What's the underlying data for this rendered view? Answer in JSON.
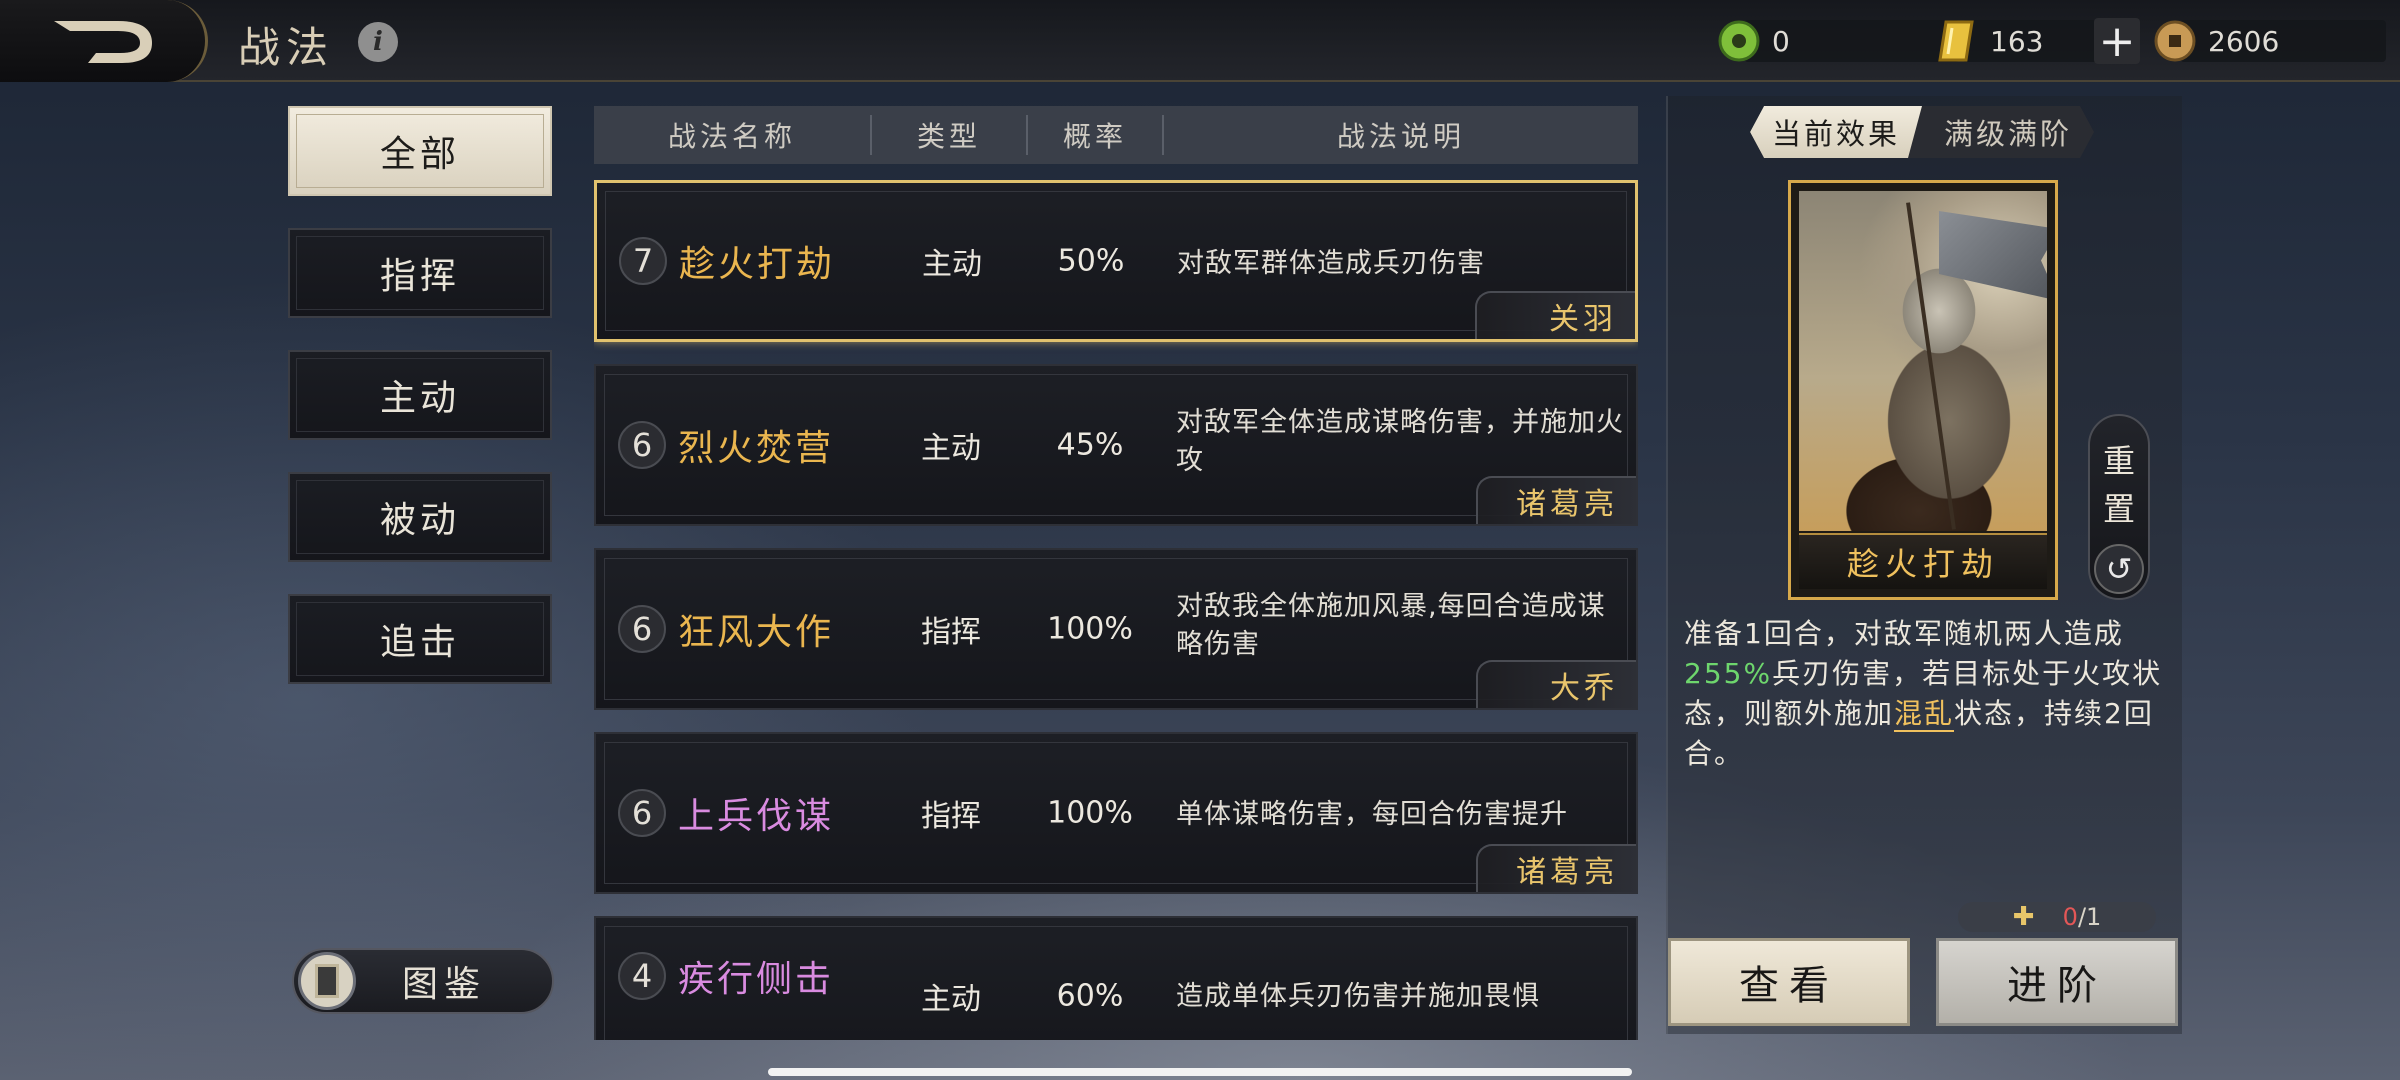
{
  "header": {
    "title": "战法",
    "resources": [
      {
        "icon": "jade-icon",
        "value": "0"
      },
      {
        "icon": "gold-ingot-icon",
        "value": "163"
      },
      {
        "icon": "copper-coin-icon",
        "value": "2606"
      }
    ],
    "plus_label": "+"
  },
  "filters": [
    {
      "label": "全部",
      "active": true
    },
    {
      "label": "指挥"
    },
    {
      "label": "主动"
    },
    {
      "label": "被动"
    },
    {
      "label": "追击"
    }
  ],
  "atlas_label": "图鉴",
  "table": {
    "headers": [
      "战法名称",
      "类型",
      "概率",
      "战法说明"
    ],
    "rows": [
      {
        "level": "7",
        "name": "趁火打劫",
        "type": "主动",
        "rate": "50%",
        "desc": "对敌军群体造成兵刃伤害",
        "owner": "关羽",
        "color": "#eab64f"
      },
      {
        "level": "6",
        "name": "烈火焚营",
        "type": "主动",
        "rate": "45%",
        "desc": "对敌军全体造成谋略伤害，并施加火攻",
        "owner": "诸葛亮",
        "color": "#eab64f"
      },
      {
        "level": "6",
        "name": "狂风大作",
        "type": "指挥",
        "rate": "100%",
        "desc": "对敌我全体施加风暴,每回合造成谋略伤害",
        "owner": "大乔",
        "color": "#eab64f"
      },
      {
        "level": "6",
        "name": "上兵伐谋",
        "type": "指挥",
        "rate": "100%",
        "desc": "单体谋略伤害，每回合伤害提升",
        "owner": "诸葛亮",
        "color": "#d98be0"
      },
      {
        "level": "4",
        "name": "疾行侧击",
        "type": "主动",
        "rate": "60%",
        "desc": "造成单体兵刃伤害并施加畏惧",
        "owner": "",
        "color": "#d98be0"
      }
    ]
  },
  "detail": {
    "toggle_on": "当前效果",
    "toggle_off": "满级满阶",
    "card_name": "趁火打劫",
    "reset_label_1": "重",
    "reset_label_2": "置",
    "effect_1": "准备1回合，对敌军随机两人造成",
    "effect_pct": "255%",
    "effect_2": "兵刃伤害，若目标处于火攻状态，则额外施加",
    "effect_status": "混乱",
    "effect_3": "状态，持续2回合。",
    "pieces_current": "0",
    "pieces_total": "/1",
    "view_label": "查看",
    "advance_label": "进阶"
  }
}
